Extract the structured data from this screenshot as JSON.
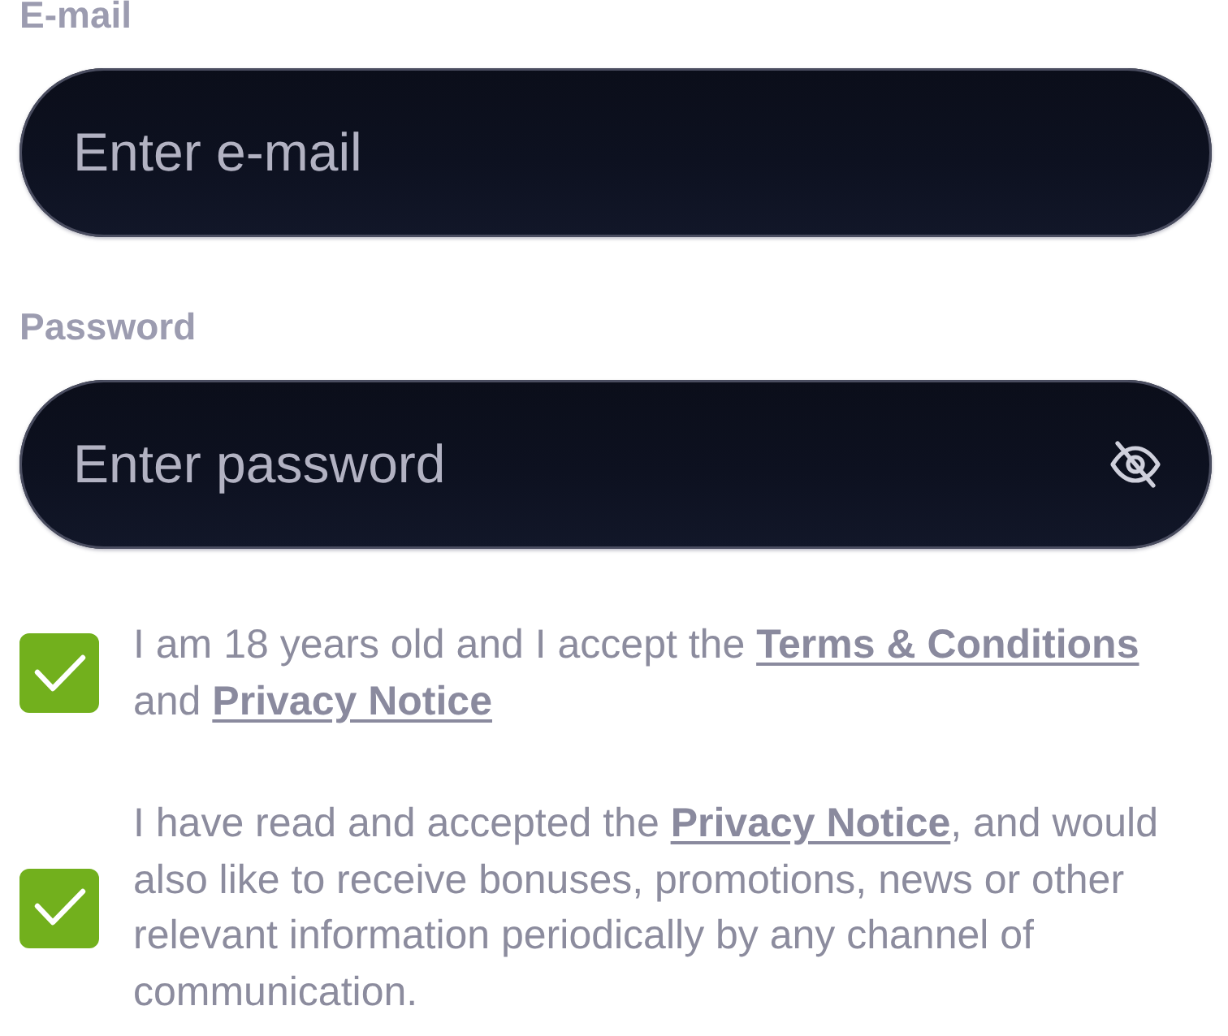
{
  "fields": [
    {
      "kind": "email",
      "label": "E-mail",
      "placeholder": "Enter e-mail"
    },
    {
      "kind": "password",
      "label": "Password",
      "placeholder": "Enter password"
    }
  ],
  "consents": [
    {
      "checked": true,
      "parts": [
        {
          "kind": "text",
          "text": "I am 18 years old and I accept the "
        },
        {
          "kind": "link",
          "text": "Terms & Conditions"
        },
        {
          "kind": "text",
          "text": " and "
        },
        {
          "kind": "link",
          "text": "Privacy Notice"
        }
      ]
    },
    {
      "checked": true,
      "parts": [
        {
          "kind": "text",
          "text": "I have read and accepted the "
        },
        {
          "kind": "link",
          "text": "Privacy Notice"
        },
        {
          "kind": "text",
          "text": ", and would also like to receive bonuses, promotions, news or other relevant information periodically by any channel of communication."
        }
      ]
    }
  ]
}
